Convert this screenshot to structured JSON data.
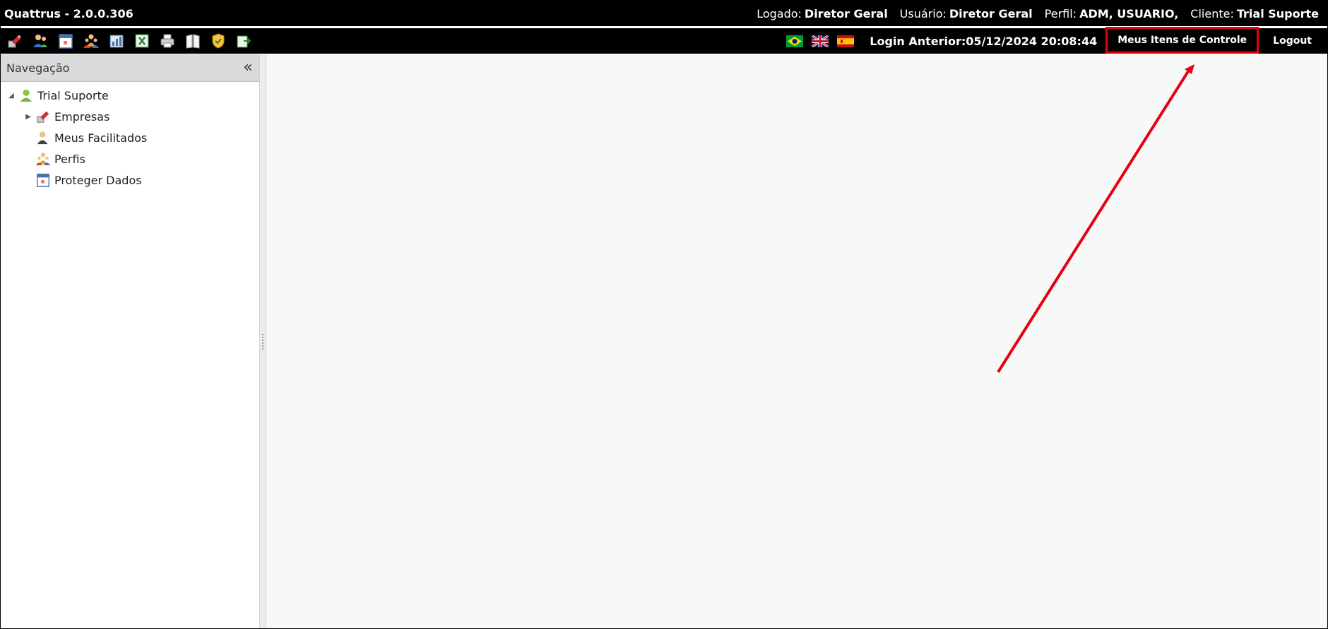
{
  "titlebar": {
    "app_title": "Quattrus - 2.0.0.306",
    "session": [
      {
        "label": "Logado:",
        "value": "Diretor Geral"
      },
      {
        "label": "Usuário:",
        "value": "Diretor Geral"
      },
      {
        "label": "Perfil:",
        "value": "ADM, USUARIO,"
      },
      {
        "label": "Cliente:",
        "value": "Trial Suporte"
      }
    ]
  },
  "toolbar": {
    "icons": [
      "companies-icon",
      "users-icon",
      "calendar-icon",
      "profiles-icon",
      "reports-icon",
      "excel-icon",
      "print-icon",
      "book-icon",
      "shield-icon",
      "export-icon"
    ],
    "flags": [
      "brazil-flag-icon",
      "uk-flag-icon",
      "spain-flag-icon"
    ],
    "login_prev_label": "Login Anterior:",
    "login_prev_value": "05/12/2024 20:08:44",
    "meus_itens_label": "Meus Itens de Controle",
    "logout_label": "Logout"
  },
  "sidebar": {
    "title": "Navegação",
    "tree": [
      {
        "label": "Trial Suporte",
        "icon": "client-icon",
        "level": 0,
        "expanded": true
      },
      {
        "label": "Empresas",
        "icon": "companies-icon",
        "level": 1,
        "expandable": true
      },
      {
        "label": "Meus Facilitados",
        "icon": "user-icon",
        "level": 1
      },
      {
        "label": "Perfis",
        "icon": "profiles-icon",
        "level": 1
      },
      {
        "label": "Proteger Dados",
        "icon": "calendar-icon",
        "level": 1
      }
    ]
  },
  "colors": {
    "bar_bg": "#000000",
    "highlight": "#e60012",
    "main_bg": "#f7f8f8",
    "sidebar_header": "#d9dadb"
  }
}
